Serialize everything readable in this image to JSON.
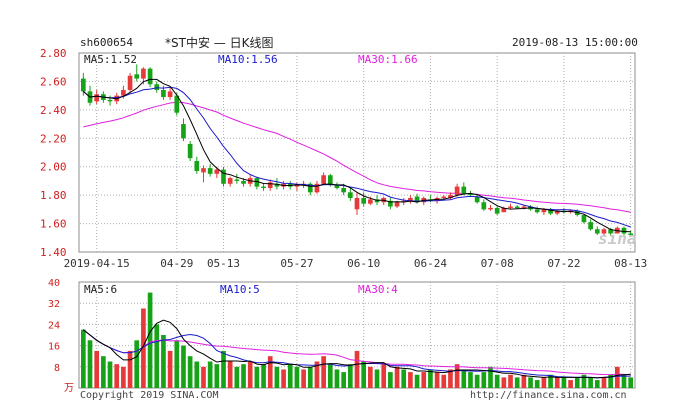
{
  "header": {
    "symbol": "sh600654",
    "title": "*ST中安 — 日K线图",
    "datetime": "2019-08-13 15:00:00"
  },
  "price_legend": {
    "ma5": "MA5:1.52",
    "ma10": "MA10:1.56",
    "ma30": "MA30:1.66"
  },
  "volume_legend": {
    "ma5": "MA5:6",
    "ma10": "MA10:5",
    "ma30": "MA30:4"
  },
  "volume_unit": "万",
  "footer": {
    "left": "Copyright 2019 SINA.COM",
    "right": "http://finance.sina.com.cn"
  },
  "watermark": "sina",
  "colors": {
    "up": "#e63a3a",
    "down": "#17a317",
    "ma5": "#000000",
    "ma10": "#1a1acc",
    "ma30": "#e020e0",
    "axis": "#d02020"
  },
  "chart_data": [
    {
      "type": "candlestick",
      "ylim": [
        1.4,
        2.8
      ],
      "yticks": [
        "2.80",
        "2.60",
        "2.40",
        "2.20",
        "2.00",
        "1.80",
        "1.60",
        "1.40"
      ],
      "xticks": [
        {
          "i": 2,
          "label": "2019-04-15"
        },
        {
          "i": 14,
          "label": "04-29"
        },
        {
          "i": 21,
          "label": "05-13"
        },
        {
          "i": 32,
          "label": "05-27"
        },
        {
          "i": 42,
          "label": "06-10"
        },
        {
          "i": 52,
          "label": "06-24"
        },
        {
          "i": 62,
          "label": "07-08"
        },
        {
          "i": 72,
          "label": "07-22"
        },
        {
          "i": 82,
          "label": "08-13"
        }
      ],
      "ohlc": [
        [
          2.62,
          2.66,
          2.5,
          2.53
        ],
        [
          2.53,
          2.57,
          2.43,
          2.45
        ],
        [
          2.46,
          2.54,
          2.44,
          2.51
        ],
        [
          2.51,
          2.53,
          2.45,
          2.47
        ],
        [
          2.47,
          2.5,
          2.43,
          2.46
        ],
        [
          2.46,
          2.52,
          2.44,
          2.5
        ],
        [
          2.5,
          2.57,
          2.48,
          2.54
        ],
        [
          2.54,
          2.66,
          2.52,
          2.64
        ],
        [
          2.65,
          2.72,
          2.6,
          2.62
        ],
        [
          2.62,
          2.7,
          2.58,
          2.69
        ],
        [
          2.69,
          2.7,
          2.56,
          2.58
        ],
        [
          2.58,
          2.6,
          2.52,
          2.54
        ],
        [
          2.54,
          2.57,
          2.47,
          2.49
        ],
        [
          2.49,
          2.56,
          2.47,
          2.53
        ],
        [
          2.5,
          2.52,
          2.36,
          2.38
        ],
        [
          2.3,
          2.34,
          2.18,
          2.2
        ],
        [
          2.16,
          2.18,
          2.04,
          2.06
        ],
        [
          2.04,
          2.07,
          1.95,
          1.97
        ],
        [
          1.96,
          2.01,
          1.89,
          1.99
        ],
        [
          1.99,
          2.02,
          1.93,
          1.95
        ],
        [
          1.95,
          2.0,
          1.92,
          1.98
        ],
        [
          1.98,
          2.0,
          1.86,
          1.88
        ],
        [
          1.88,
          1.93,
          1.86,
          1.92
        ],
        [
          1.91,
          1.95,
          1.88,
          1.9
        ],
        [
          1.9,
          1.92,
          1.86,
          1.88
        ],
        [
          1.88,
          1.94,
          1.86,
          1.92
        ],
        [
          1.92,
          1.93,
          1.84,
          1.86
        ],
        [
          1.86,
          1.88,
          1.83,
          1.85
        ],
        [
          1.85,
          1.91,
          1.83,
          1.89
        ],
        [
          1.88,
          1.92,
          1.84,
          1.86
        ],
        [
          1.86,
          1.9,
          1.84,
          1.88
        ],
        [
          1.88,
          1.9,
          1.84,
          1.86
        ],
        [
          1.86,
          1.89,
          1.83,
          1.87
        ],
        [
          1.87,
          1.9,
          1.85,
          1.88
        ],
        [
          1.88,
          1.89,
          1.8,
          1.82
        ],
        [
          1.82,
          1.9,
          1.81,
          1.88
        ],
        [
          1.88,
          1.96,
          1.87,
          1.94
        ],
        [
          1.94,
          1.95,
          1.86,
          1.87
        ],
        [
          1.87,
          1.89,
          1.84,
          1.85
        ],
        [
          1.85,
          1.88,
          1.8,
          1.82
        ],
        [
          1.82,
          1.86,
          1.76,
          1.78
        ],
        [
          1.7,
          1.82,
          1.66,
          1.78
        ],
        [
          1.78,
          1.82,
          1.72,
          1.74
        ],
        [
          1.74,
          1.79,
          1.73,
          1.77
        ],
        [
          1.77,
          1.8,
          1.73,
          1.75
        ],
        [
          1.75,
          1.79,
          1.73,
          1.78
        ],
        [
          1.76,
          1.78,
          1.7,
          1.72
        ],
        [
          1.72,
          1.76,
          1.71,
          1.75
        ],
        [
          1.75,
          1.78,
          1.73,
          1.76
        ],
        [
          1.76,
          1.8,
          1.74,
          1.78
        ],
        [
          1.79,
          1.81,
          1.74,
          1.75
        ],
        [
          1.75,
          1.79,
          1.73,
          1.78
        ],
        [
          1.77,
          1.8,
          1.75,
          1.76
        ],
        [
          1.76,
          1.79,
          1.74,
          1.78
        ],
        [
          1.78,
          1.8,
          1.76,
          1.79
        ],
        [
          1.78,
          1.82,
          1.77,
          1.8
        ],
        [
          1.8,
          1.88,
          1.79,
          1.86
        ],
        [
          1.86,
          1.89,
          1.8,
          1.81
        ],
        [
          1.81,
          1.83,
          1.79,
          1.8
        ],
        [
          1.79,
          1.81,
          1.74,
          1.75
        ],
        [
          1.75,
          1.77,
          1.69,
          1.7
        ],
        [
          1.7,
          1.73,
          1.69,
          1.71
        ],
        [
          1.71,
          1.72,
          1.66,
          1.67
        ],
        [
          1.68,
          1.72,
          1.68,
          1.71
        ],
        [
          1.71,
          1.74,
          1.7,
          1.72
        ],
        [
          1.72,
          1.73,
          1.7,
          1.71
        ],
        [
          1.71,
          1.73,
          1.7,
          1.72
        ],
        [
          1.72,
          1.73,
          1.69,
          1.7
        ],
        [
          1.7,
          1.72,
          1.67,
          1.68
        ],
        [
          1.68,
          1.71,
          1.66,
          1.7
        ],
        [
          1.7,
          1.71,
          1.66,
          1.67
        ],
        [
          1.67,
          1.7,
          1.66,
          1.69
        ],
        [
          1.69,
          1.71,
          1.67,
          1.68
        ],
        [
          1.68,
          1.7,
          1.67,
          1.69
        ],
        [
          1.69,
          1.7,
          1.65,
          1.66
        ],
        [
          1.66,
          1.67,
          1.6,
          1.61
        ],
        [
          1.61,
          1.63,
          1.55,
          1.56
        ],
        [
          1.56,
          1.58,
          1.52,
          1.53
        ],
        [
          1.53,
          1.57,
          1.51,
          1.56
        ],
        [
          1.56,
          1.57,
          1.52,
          1.53
        ],
        [
          1.53,
          1.58,
          1.53,
          1.57
        ],
        [
          1.57,
          1.58,
          1.52,
          1.53
        ],
        [
          1.53,
          1.55,
          1.51,
          1.52
        ]
      ]
    },
    {
      "type": "bar",
      "ylim": [
        0,
        40
      ],
      "yticks": [
        "40",
        "32",
        "24",
        "16",
        "8"
      ],
      "volume": [
        22,
        18,
        14,
        12,
        10,
        9,
        8,
        14,
        18,
        30,
        36,
        24,
        20,
        14,
        18,
        16,
        12,
        10,
        8,
        10,
        9,
        14,
        10,
        8,
        9,
        10,
        8,
        9,
        12,
        8,
        7,
        9,
        8,
        7,
        8,
        10,
        12,
        9,
        7,
        6,
        9,
        14,
        10,
        8,
        7,
        9,
        6,
        8,
        7,
        6,
        5,
        6,
        7,
        6,
        5,
        7,
        9,
        7,
        6,
        5,
        6,
        8,
        5,
        4,
        5,
        4,
        5,
        4,
        3,
        4,
        5,
        4,
        4,
        3,
        4,
        5,
        4,
        3,
        4,
        5,
        8,
        5,
        4
      ],
      "up_days": [
        2,
        5,
        6,
        7,
        9,
        13,
        18,
        22,
        25,
        28,
        30,
        33,
        35,
        36,
        41,
        43,
        45,
        47,
        49,
        51,
        53,
        54,
        55,
        56,
        63,
        64,
        66,
        69,
        71,
        73,
        78,
        80
      ]
    }
  ]
}
